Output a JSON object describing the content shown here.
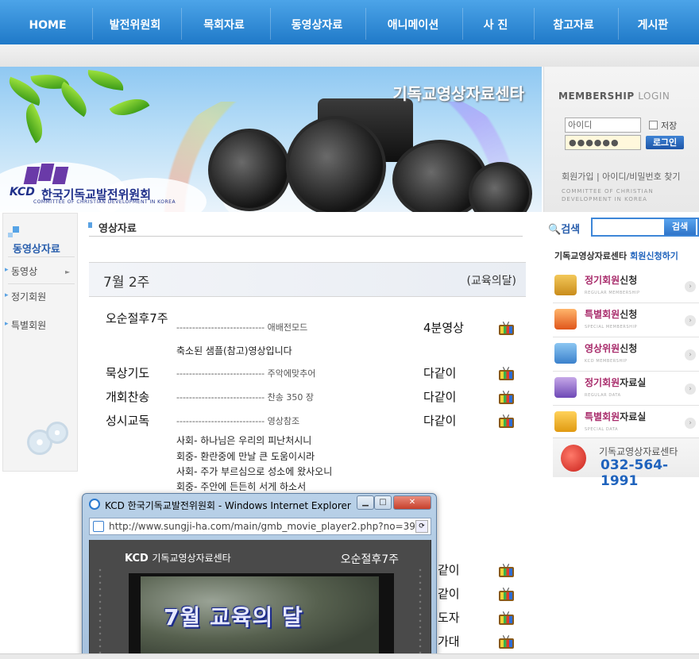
{
  "nav": {
    "items": [
      "HOME",
      "발전위원회",
      "목회자료",
      "동영상자료",
      "애니메이션",
      "사 진",
      "참고자료",
      "게시판"
    ]
  },
  "banner": {
    "title": "기독교영상자료센타",
    "logo_mark": "KCD",
    "logo_korean": "한국기독교발전위원회",
    "logo_english": "COMMITTEE OF CHRISTIAN DEVELOPMENT IN KOREA"
  },
  "membership": {
    "heading_bold": "MEMBERSHIP",
    "heading_light": "LOGIN",
    "id_placeholder": "아이디",
    "password_mask": "●●●●●●",
    "save_label": "저장",
    "login_label": "로그인",
    "links": "회원가입 | 아이디/비밀번호 찾기",
    "committee_text": "COMMITTEE OF CHRISTIAN DEVELOPMENT IN KOREA"
  },
  "left_menu": {
    "title": "동영상자료",
    "items": [
      "동영상",
      "정기회원",
      "특별회원"
    ]
  },
  "content": {
    "section_title": "영상자료",
    "week": "7월 2주",
    "theme": "(교육의달)",
    "rows": [
      {
        "name": "오순절후7주",
        "dash": "---------------------------- 애배전모드",
        "value": "4분영상"
      },
      {
        "name": "묵상기도",
        "dash": "---------------------------- 주악에맞추어",
        "value": "다같이"
      },
      {
        "name": "개회찬송",
        "dash": "---------------------------- 찬송 350 장",
        "value": "다같이"
      },
      {
        "name": "성시교독",
        "dash": "---------------------------- 영상참조",
        "value": "다같이"
      }
    ],
    "sample_note": "축소된 샘플(참고)영상입니다",
    "responsive_lines": [
      "사회- 하나님은 우리의 피난처시니",
      "회중- 환란중에 만날 큰 도움이시라",
      "사회- 주가 부르심으로 성소에 왔사오니",
      "회중- 주안에 든든히 서게 하소서"
    ],
    "partial_values": [
      "같이",
      "같이",
      "도자",
      "가대"
    ]
  },
  "right": {
    "search_label": "검색",
    "search_button": "검색",
    "join_prefix": "기독교영상자료센타",
    "join_link": "회원신청하기",
    "menu": [
      {
        "title": "정기회원",
        "suffix": "신청",
        "sub": "REGULAR MEMBERSHIP"
      },
      {
        "title": "특별회원",
        "suffix": "신청",
        "sub": "SPECIAL MEMBERSHIP"
      },
      {
        "title": "영상위원",
        "suffix": "신청",
        "sub": "KCD MEMBERSHIP"
      },
      {
        "title": "정기회원",
        "suffix": "자료실",
        "sub": "REGULAR DATA"
      },
      {
        "title": "특별회원",
        "suffix": "자료실",
        "sub": "SPECIAL DATA"
      }
    ],
    "phone_label": "기독교영상자료센타",
    "phone_number": "032-564-1991"
  },
  "popup": {
    "window_title": "KCD 한국기독교발전위원회 - Windows Internet Explorer",
    "url": "http://www.sungji-ha.com/main/gmb_movie_player2.php?no=39",
    "player_brand": "KCD",
    "player_brand_sub": "기독교영상자료센타",
    "player_episode": "오순절후7주",
    "video_caption": "7월 교육의 달"
  },
  "colors": {
    "nav_blue": "#1f79c8",
    "accent_blue": "#1f63bd",
    "accent_magenta": "#a82a6a"
  }
}
